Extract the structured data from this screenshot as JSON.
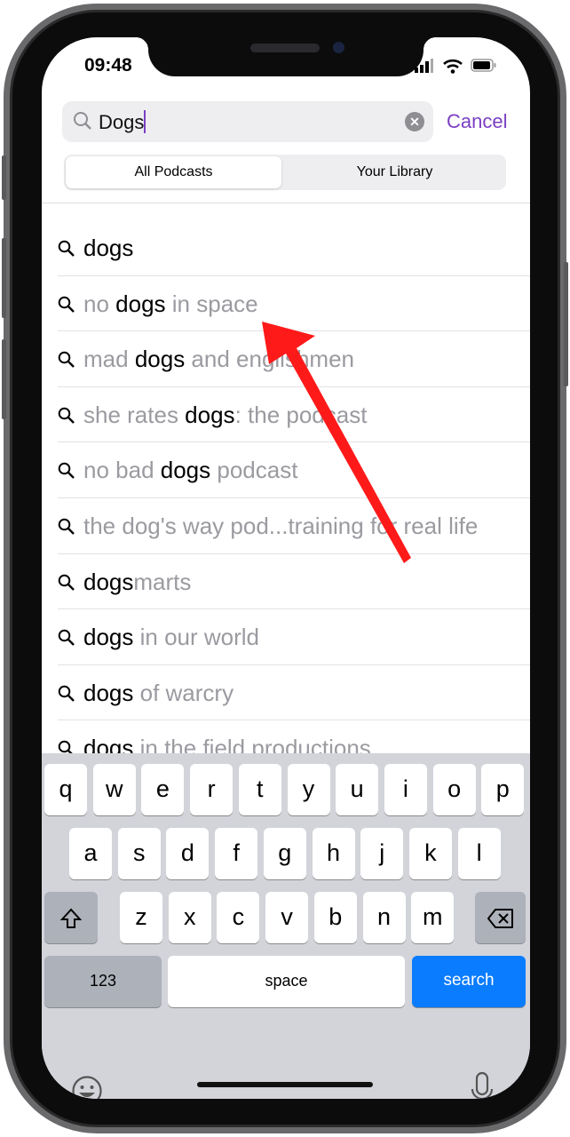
{
  "status_bar": {
    "time": "09:48",
    "icons": [
      "signal-icon",
      "wifi-icon",
      "battery-icon"
    ]
  },
  "search": {
    "value": "Dogs",
    "cancel_label": "Cancel"
  },
  "segments": {
    "all": "All Podcasts",
    "library": "Your Library",
    "selected": "All Podcasts"
  },
  "suggestions": [
    {
      "pre": "",
      "match": "dogs",
      "post": ""
    },
    {
      "pre": "no ",
      "match": "dogs",
      "post": " in space"
    },
    {
      "pre": "mad ",
      "match": "dogs",
      "post": " and englishmen"
    },
    {
      "pre": "she rates ",
      "match": "dogs",
      "post": ": the podcast"
    },
    {
      "pre": "no bad ",
      "match": "dogs",
      "post": " podcast"
    },
    {
      "pre": "the dog's way pod...training for real life",
      "match": "",
      "post": ""
    },
    {
      "pre": "",
      "match": "dogs",
      "post": "marts"
    },
    {
      "pre": "",
      "match": "dogs",
      "post": " in our world"
    },
    {
      "pre": "",
      "match": "dogs",
      "post": " of warcry"
    },
    {
      "pre": "",
      "match": "dogs",
      "post": " in the field productions"
    }
  ],
  "keyboard": {
    "row1": [
      "q",
      "w",
      "e",
      "r",
      "t",
      "y",
      "u",
      "i",
      "o",
      "p"
    ],
    "row2": [
      "a",
      "s",
      "d",
      "f",
      "g",
      "h",
      "j",
      "k",
      "l"
    ],
    "row3": [
      "z",
      "x",
      "c",
      "v",
      "b",
      "n",
      "m"
    ],
    "numbers": "123",
    "space": "space",
    "search": "search"
  },
  "colors": {
    "accent": "#7b3fc4",
    "search_key": "#0a7cff",
    "annotation_arrow": "#ff1a1a"
  }
}
